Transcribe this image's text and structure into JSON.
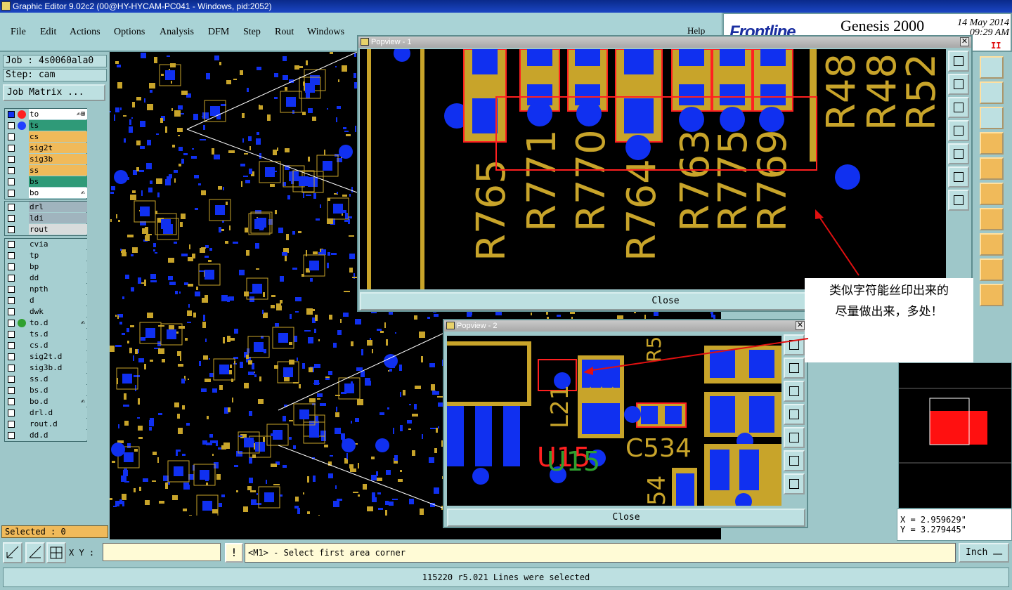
{
  "window": {
    "title": "Graphic Editor 9.02c2 (00@HY-HYCAM-PC041 - Windows, pid:2052)"
  },
  "menu": {
    "items": [
      "File",
      "Edit",
      "Actions",
      "Options",
      "Analysis",
      "DFM",
      "Step",
      "Rout",
      "Windows"
    ],
    "help": "Help"
  },
  "brand": {
    "logo": "Frontline",
    "product": "Genesis 2000",
    "date": "14 May 2014",
    "time": "09:29 AM",
    "pause": "II"
  },
  "job": {
    "job_label": "Job : 4s0060ala0",
    "step_label": "Step: cam",
    "matrix_button": "Job Matrix ..."
  },
  "layers": {
    "group1": [
      {
        "name": "to",
        "color": "#ffffff",
        "dot": "#ff2020",
        "mark": "✍⊞"
      },
      {
        "name": "ts",
        "color": "#2f9a78",
        "dot": "#2040ff",
        "mark": ""
      },
      {
        "name": "cs",
        "color": "#f0ba5a",
        "dot": "",
        "mark": ""
      },
      {
        "name": "sig2t",
        "color": "#f0ba5a",
        "dot": "",
        "mark": ""
      },
      {
        "name": "sig3b",
        "color": "#f0ba5a",
        "dot": "",
        "mark": ""
      },
      {
        "name": "ss",
        "color": "#f0ba5a",
        "dot": "",
        "mark": ""
      },
      {
        "name": "bs",
        "color": "#2f9a78",
        "dot": "",
        "mark": ""
      },
      {
        "name": "bo",
        "color": "#ffffff",
        "dot": "",
        "mark": "✍"
      }
    ],
    "group2": [
      {
        "name": "drl",
        "color": "#a0b4be",
        "dot": "",
        "mark": ""
      },
      {
        "name": "ldi",
        "color": "#a0b4be",
        "dot": "",
        "mark": ""
      },
      {
        "name": "rout",
        "color": "#d8dcdc",
        "dot": "",
        "mark": ""
      }
    ],
    "group3": [
      {
        "name": "cvia",
        "color": "#a6cfd1",
        "dot": "",
        "mark": ""
      },
      {
        "name": "tp",
        "color": "#a6cfd1",
        "dot": "",
        "mark": ""
      },
      {
        "name": "bp",
        "color": "#a6cfd1",
        "dot": "",
        "mark": ""
      },
      {
        "name": "dd",
        "color": "#a6cfd1",
        "dot": "",
        "mark": ""
      },
      {
        "name": "npth",
        "color": "#a6cfd1",
        "dot": "",
        "mark": ""
      },
      {
        "name": "d",
        "color": "#a6cfd1",
        "dot": "",
        "mark": ""
      },
      {
        "name": "dwk",
        "color": "#a6cfd1",
        "dot": "",
        "mark": ""
      },
      {
        "name": "to.d",
        "color": "#a6cfd1",
        "dot": "#2fa02f",
        "mark": "✍"
      },
      {
        "name": "ts.d",
        "color": "#a6cfd1",
        "dot": "",
        "mark": ""
      },
      {
        "name": "cs.d",
        "color": "#a6cfd1",
        "dot": "",
        "mark": ""
      },
      {
        "name": "sig2t.d",
        "color": "#a6cfd1",
        "dot": "",
        "mark": ""
      },
      {
        "name": "sig3b.d",
        "color": "#a6cfd1",
        "dot": "",
        "mark": ""
      },
      {
        "name": "ss.d",
        "color": "#a6cfd1",
        "dot": "",
        "mark": ""
      },
      {
        "name": "bs.d",
        "color": "#a6cfd1",
        "dot": "",
        "mark": ""
      },
      {
        "name": "bo.d",
        "color": "#a6cfd1",
        "dot": "",
        "mark": "✍"
      },
      {
        "name": "drl.d",
        "color": "#a6cfd1",
        "dot": "",
        "mark": ""
      },
      {
        "name": "rout.d",
        "color": "#a6cfd1",
        "dot": "",
        "mark": ""
      },
      {
        "name": "dd.d",
        "color": "#a6cfd1",
        "dot": "",
        "mark": ""
      }
    ]
  },
  "selected": "Selected : 0",
  "popview1": {
    "title": "Popview - 1",
    "close": "Close",
    "labels_vertical": [
      "R765",
      "R771",
      "R770",
      "R764",
      "R763",
      "R775",
      "R769"
    ],
    "labels_right": [
      "R48",
      "R48",
      "R52"
    ]
  },
  "popview2": {
    "title": "Popview - 2",
    "close": "Close",
    "labels": {
      "l21": "L21",
      "u15": "U15",
      "c534": "C534",
      "r5": "R5",
      "n54": "54"
    }
  },
  "annotation": {
    "line1": "类似字符能丝印出来的",
    "line2": "尽量做出来，多处！"
  },
  "coords": {
    "x": "X = 2.959629\"",
    "y": "Y = 3.279445\""
  },
  "bottom": {
    "xy_label": "X Y :",
    "xy_value": "",
    "excl": "!",
    "prompt": "<M1> - Select first area corner",
    "units": "Inch"
  },
  "status": "115220 r5.021 Lines were selected",
  "colors": {
    "silk": "#c8a42a",
    "copper": "#1030f0",
    "outline": "#ff2020",
    "panel": "#9ec7c9"
  }
}
